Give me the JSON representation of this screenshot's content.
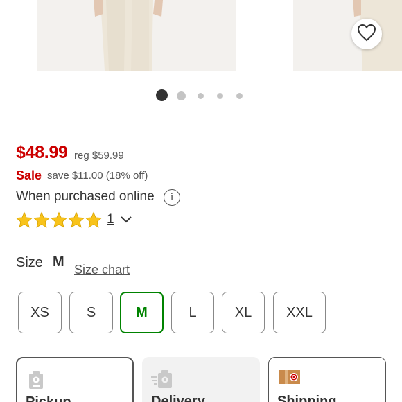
{
  "gallery": {
    "favorite_icon": "heart-outline-icon",
    "dots_total": 5,
    "dots_active_index": 0
  },
  "pricing": {
    "price": "$48.99",
    "regular": "reg $59.99",
    "sale_label": "Sale",
    "savings": "save $11.00 (18% off)",
    "online_note": "When purchased online",
    "info_icon": "i"
  },
  "rating": {
    "stars": 5,
    "max_stars": 5,
    "review_count": "1"
  },
  "size": {
    "label": "Size",
    "selected": "M",
    "chart_link": "Size chart",
    "options": [
      "XS",
      "S",
      "M",
      "L",
      "XL",
      "XXL"
    ]
  },
  "fulfillment": {
    "options": [
      {
        "title": "Pickup",
        "icon": "store-pickup-icon"
      },
      {
        "title": "Delivery",
        "icon": "delivery-icon"
      },
      {
        "title": "Shipping",
        "icon": "shipping-box-icon"
      }
    ]
  },
  "colors": {
    "sale_red": "#cc0000",
    "selected_green": "#008300"
  }
}
